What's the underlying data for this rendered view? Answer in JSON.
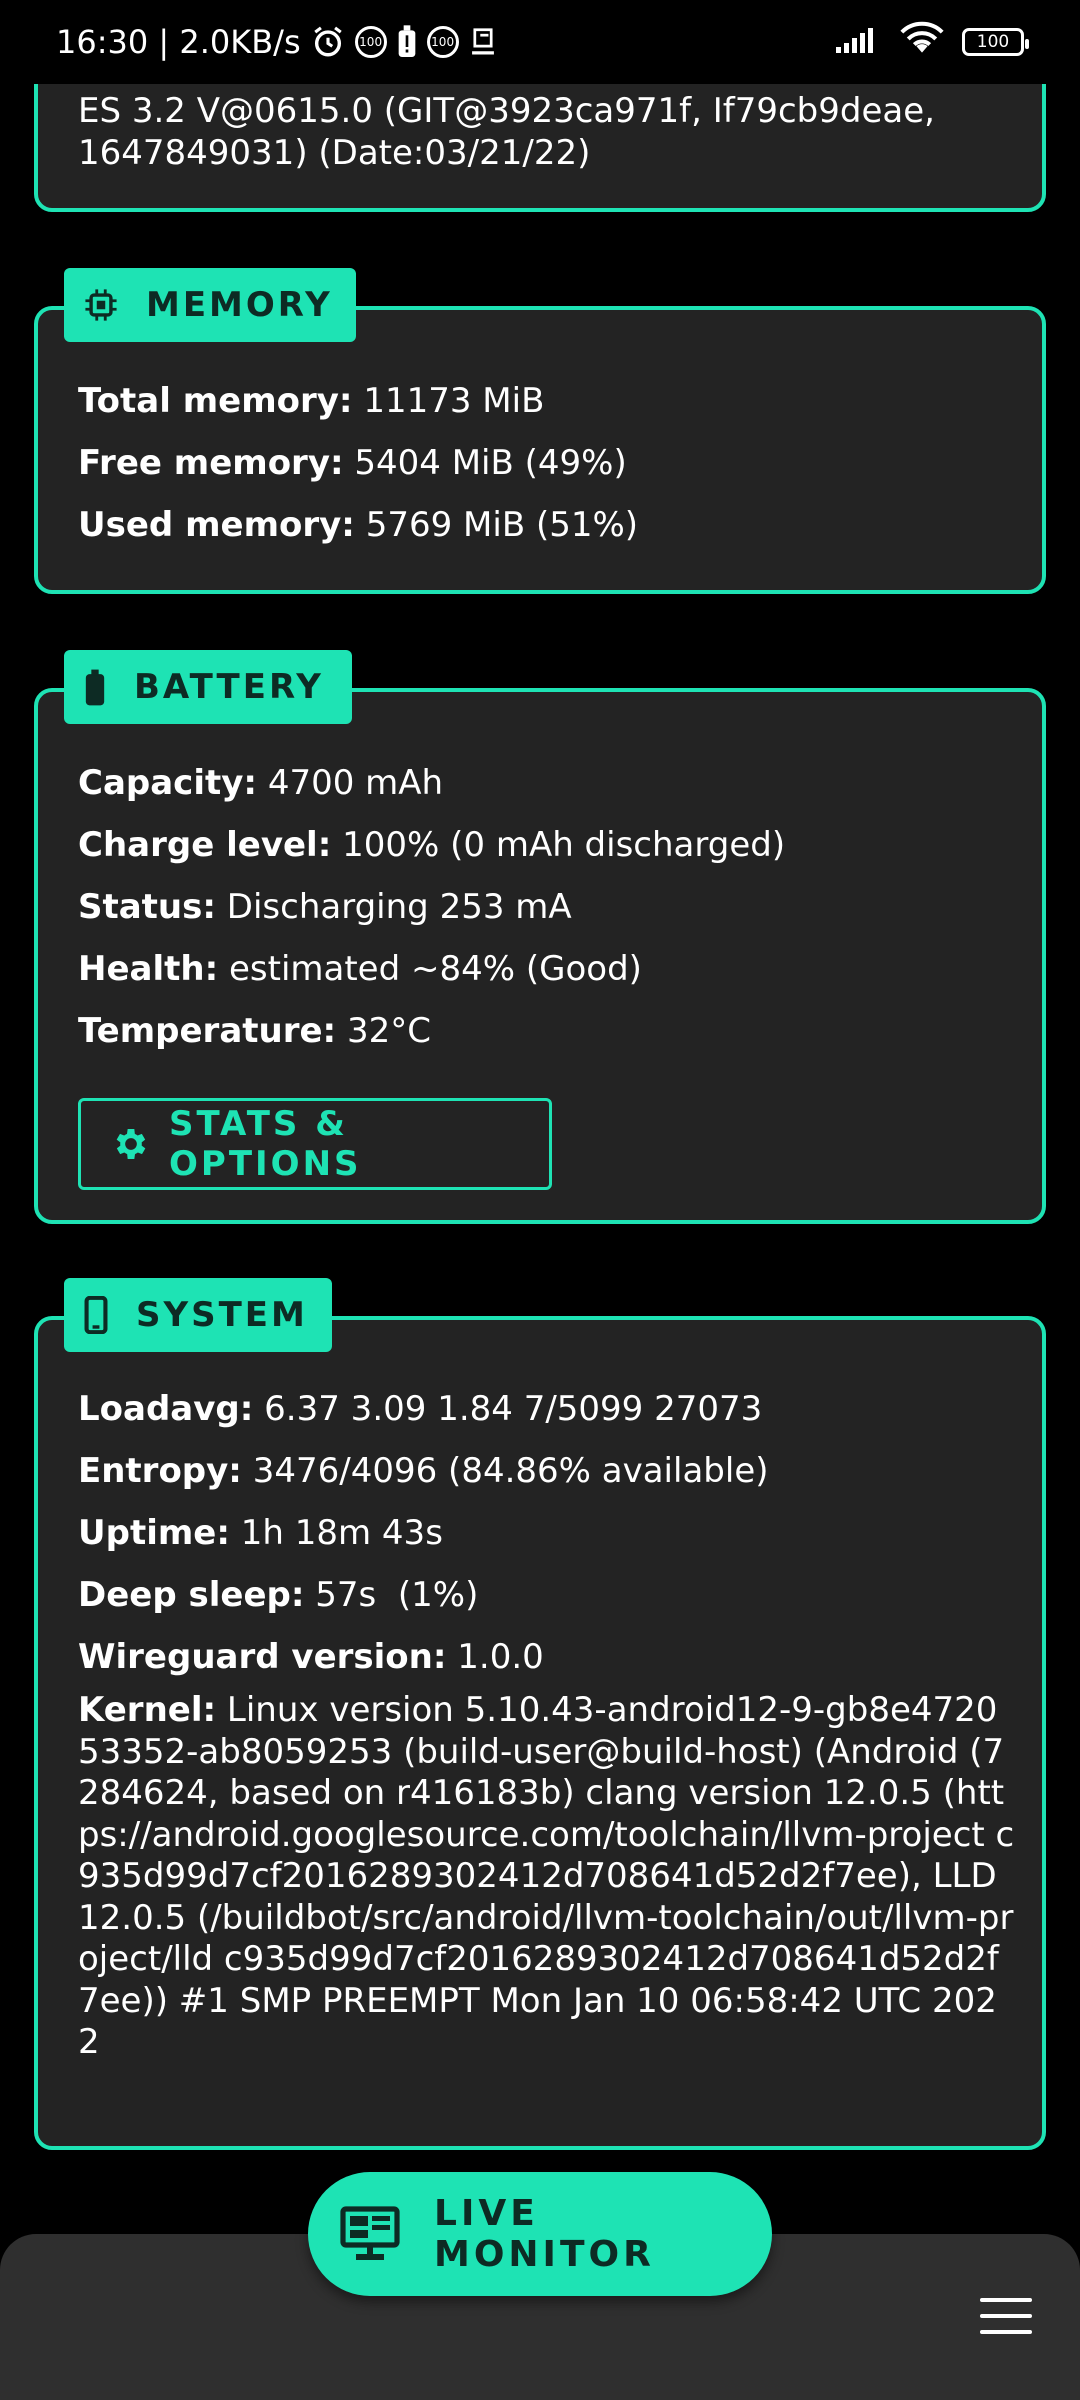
{
  "status_bar": {
    "time_speed": "16:30 | 2.0KB/s",
    "badge_1": "100",
    "badge_2": "100",
    "battery": "100"
  },
  "gpu_card": {
    "tail_line_1": "ES 3.2 V@0615.0 (GIT@3923ca971f, If79cb9deae,",
    "tail_line_2": "1647849031) (Date:03/21/22)"
  },
  "memory": {
    "title": "MEMORY",
    "rows": [
      {
        "label": "Total memory:",
        "value": "11173 MiB"
      },
      {
        "label": "Free memory:",
        "value": "5404 MiB (49%)"
      },
      {
        "label": "Used memory:",
        "value": "5769 MiB (51%)"
      }
    ]
  },
  "battery": {
    "title": "BATTERY",
    "rows": [
      {
        "label": "Capacity:",
        "value": "4700 mAh"
      },
      {
        "label": "Charge level:",
        "value": "100% (0 mAh discharged)"
      },
      {
        "label": "Status:",
        "value": "Discharging 253 mA"
      },
      {
        "label": "Health:",
        "value": "estimated ~84% (Good)"
      },
      {
        "label": "Temperature:",
        "value": "32°C"
      }
    ],
    "button": "STATS & OPTIONS"
  },
  "system": {
    "title": "SYSTEM",
    "rows": [
      {
        "label": "Loadavg:",
        "value": "6.37 3.09 1.84 7/5099 27073"
      },
      {
        "label": "Entropy:",
        "value": "3476/4096 (84.86% available)"
      },
      {
        "label": "Uptime:",
        "value": "1h 18m 43s"
      },
      {
        "label": "Deep sleep:",
        "value": "57s  (1%)"
      },
      {
        "label": "Wireguard version:",
        "value": "1.0.0"
      }
    ],
    "kernel_label": "Kernel:",
    "kernel_value": "Linux version 5.10.43-android12-9-gb8e472053352-ab8059253 (build-user@build-host) (Android (7284624, based on r416183b) clang version 12.0.5 (https://android.googlesource.com/toolchain/llvm-project c935d99d7cf2016289302412d708641d52d2f7ee), LLD 12.0.5 (/buildbot/src/android/llvm-toolchain/out/llvm-project/lld c935d99d7cf2016289302412d708641d52d2f7ee)) #1 SMP PREEMPT Mon Jan 10 06:58:42 UTC 2022"
  },
  "live_monitor_label": "LIVE MONITOR",
  "colors": {
    "accent": "#1ee3b4",
    "card_bg": "#232323",
    "bottom_bar": "#2f2f2f"
  },
  "icons": {
    "memory": "chip-icon",
    "battery": "battery-icon",
    "system": "phone-icon",
    "stats": "gear-icon",
    "live_monitor": "monitor-icon",
    "menu": "hamburger-menu-icon"
  }
}
